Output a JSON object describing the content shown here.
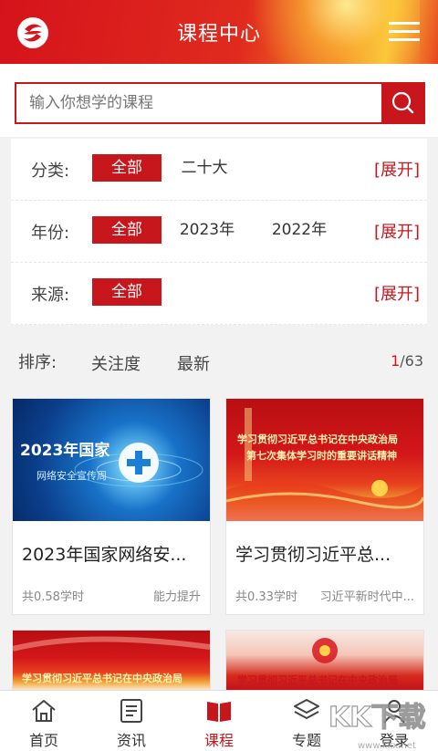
{
  "header": {
    "title": "课程中心",
    "logo_icon": "app-logo-icon",
    "menu_icon": "hamburger-menu-icon"
  },
  "search": {
    "placeholder": "输入你想学的课程",
    "button_icon": "search-icon"
  },
  "filters": [
    {
      "label": "分类:",
      "options": [
        "全部",
        "二十大"
      ],
      "selected": "全部",
      "expand": "[展开]"
    },
    {
      "label": "年份:",
      "options": [
        "全部",
        "2023年",
        "2022年"
      ],
      "selected": "全部",
      "expand": "[展开]"
    },
    {
      "label": "来源:",
      "options": [
        "全部"
      ],
      "selected": "全部",
      "expand": "[展开]"
    }
  ],
  "sort": {
    "label": "排序:",
    "options": [
      "关注度",
      "最新"
    ],
    "page_current": "1",
    "page_total": "/63"
  },
  "courses": [
    {
      "title": "2023年国家网络安...",
      "hours": "共0.58学时",
      "tag": "能力提升",
      "thumb_text_1": "2023年国家",
      "thumb_text_2": "网络安全宣传周"
    },
    {
      "title": "学习贯彻习近平总...",
      "hours": "共0.33学时",
      "tag": "习近平新时代中...",
      "thumb_text_1": "学习贯彻习近平总书记在中央政治局",
      "thumb_text_2": "第七次集体学习时的重要讲话精神"
    },
    {
      "thumb_text_1": "学习贯彻习近平总书记在中央政治局"
    },
    {
      "thumb_text_1": "学习贯彻习近平总书记在中央政治局"
    }
  ],
  "tabbar": [
    {
      "label": "首页",
      "icon": "home-icon",
      "active": false
    },
    {
      "label": "资讯",
      "icon": "news-icon",
      "active": false
    },
    {
      "label": "课程",
      "icon": "book-icon",
      "active": true
    },
    {
      "label": "专题",
      "icon": "layers-icon",
      "active": false
    },
    {
      "label": "登录",
      "icon": "user-icon",
      "active": false
    }
  ],
  "watermark": {
    "text": "KK下载",
    "sub": "www.kkx.net"
  },
  "colors": {
    "brand_red": "#c8161d",
    "header_gold": "#f9c83a"
  }
}
